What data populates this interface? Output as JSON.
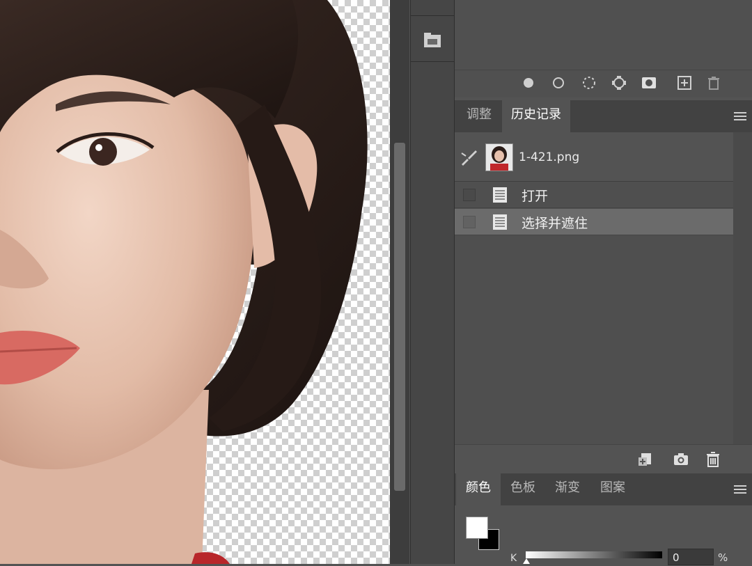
{
  "canvas": {
    "description_icon": "portrait-layer"
  },
  "paths_panel": {
    "footer_icons": [
      "fill-path-icon",
      "stroke-path-icon",
      "selection-path-icon",
      "work-path-icon",
      "mask-icon",
      "new-path-icon",
      "delete-path-icon"
    ]
  },
  "history_panel_tabs": [
    {
      "label": "调整",
      "active": false
    },
    {
      "label": "历史记录",
      "active": true
    }
  ],
  "history": {
    "snapshot_name": "1-421.png",
    "steps": [
      {
        "label": "打开",
        "selected": false
      },
      {
        "label": "选择并遮住",
        "selected": true
      }
    ],
    "footer_icons": [
      "new-document-from-state-icon",
      "camera-icon",
      "trash-icon"
    ]
  },
  "color_panel_tabs": [
    {
      "label": "颜色",
      "active": true
    },
    {
      "label": "色板",
      "active": false
    },
    {
      "label": "渐变",
      "active": false
    },
    {
      "label": "图案",
      "active": false
    }
  ],
  "color": {
    "foreground": "#ffffff",
    "background": "#000000",
    "k_label": "K",
    "k_value": "0",
    "k_unit": "%"
  }
}
